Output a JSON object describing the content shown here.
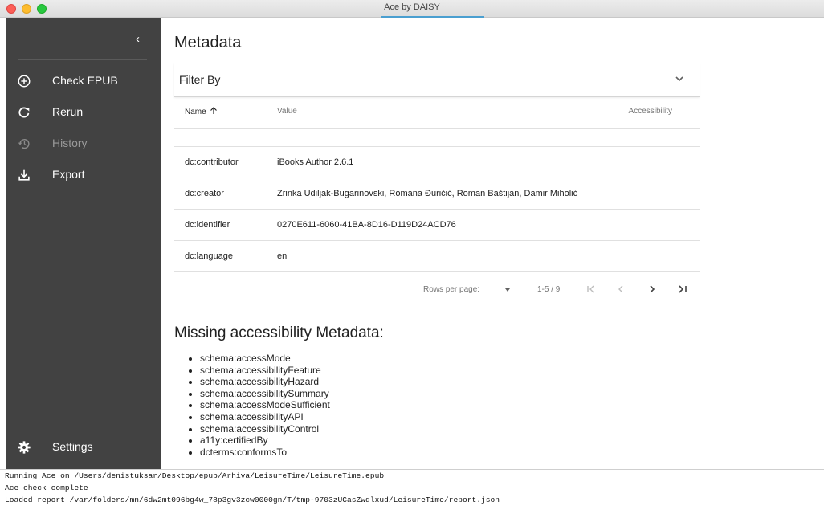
{
  "window": {
    "title": "Ace by DAISY"
  },
  "sidebar": {
    "items": [
      {
        "label": "Check EPUB",
        "icon": "plus-circle-icon"
      },
      {
        "label": "Rerun",
        "icon": "refresh-icon"
      },
      {
        "label": "History",
        "icon": "history-icon",
        "disabled": true
      },
      {
        "label": "Export",
        "icon": "download-icon"
      }
    ],
    "settings": {
      "label": "Settings",
      "icon": "gear-icon"
    }
  },
  "main": {
    "title": "Metadata",
    "filter": {
      "label": "Filter By"
    },
    "table": {
      "headers": {
        "name": "Name",
        "value": "Value",
        "accessibility": "Accessibility"
      },
      "rows": [
        {
          "name": "dc:contributor",
          "value": "iBooks Author 2.6.1"
        },
        {
          "name": "dc:creator",
          "value": "Zrinka Udiljak-Bugarinovski, Romana Đuričić, Roman Baštijan, Damir Miholić"
        },
        {
          "name": "dc:identifier",
          "value": "0270E611-6060-41BA-8D16-D119D24ACD76"
        },
        {
          "name": "dc:language",
          "value": "en"
        }
      ],
      "pagination": {
        "rows_per_page_label": "Rows per page:",
        "range": "1-5 / 9"
      }
    },
    "missing": {
      "title": "Missing accessibility Metadata:",
      "items": [
        "schema:accessMode",
        "schema:accessibilityFeature",
        "schema:accessibilityHazard",
        "schema:accessibilitySummary",
        "schema:accessModeSufficient",
        "schema:accessibilityAPI",
        "schema:accessibilityControl",
        "a11y:certifiedBy",
        "dcterms:conformsTo"
      ]
    }
  },
  "log": {
    "lines": [
      "Running Ace on /Users/denistuksar/Desktop/epub/Arhiva/LeisureTime/LeisureTime.epub",
      "Ace check complete",
      "Loaded report /var/folders/mn/6dw2mt096bg4w_78p3gv3zcw0000gn/T/tmp-9703zUCasZwdlxud/LeisureTime/report.json"
    ]
  }
}
